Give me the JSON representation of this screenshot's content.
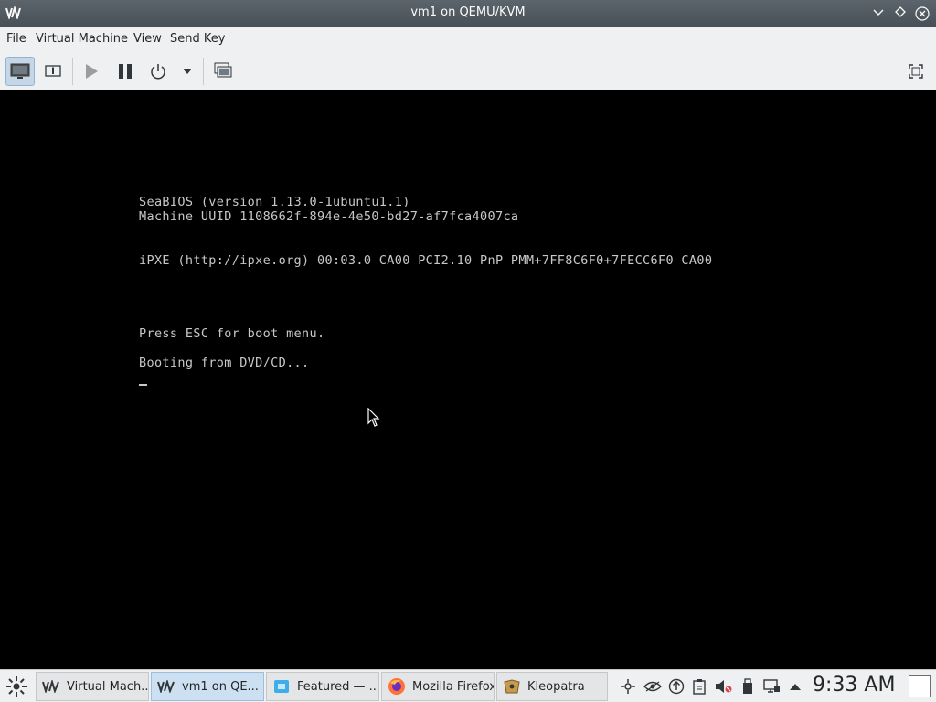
{
  "window": {
    "title": "vm1 on QEMU/KVM",
    "minimize_icon": "chevron-down-icon",
    "maximize_icon": "diamond-icon",
    "close_icon": "close-circle-icon"
  },
  "menu": {
    "items": [
      "File",
      "Virtual Machine",
      "View",
      "Send Key"
    ]
  },
  "toolbar": {
    "buttons": [
      "console-view",
      "details-view",
      "run",
      "pause",
      "shutdown",
      "shutdown-menu",
      "snapshots",
      "fullscreen"
    ],
    "active": "console-view"
  },
  "console": {
    "lines": [
      "SeaBIOS (version 1.13.0-1ubuntu1.1)",
      "Machine UUID 1108662f-894e-4e50-bd27-af7fca4007ca",
      "iPXE (http://ipxe.org) 00:03.0 CA00 PCI2.10 PnP PMM+7FF8C6F0+7FECC6F0 CA00",
      "Press ESC for boot menu.",
      "Booting from DVD/CD..."
    ],
    "text_color": "#c8c8c8",
    "background": "#000000"
  },
  "taskbar": {
    "tasks": [
      {
        "label": "Virtual Mach...",
        "icon": "virt-manager-icon",
        "active": false
      },
      {
        "label": "vm1 on QE...",
        "icon": "virt-manager-icon",
        "active": true
      },
      {
        "label": "Featured — ...",
        "icon": "discover-icon",
        "active": false
      },
      {
        "label": "Mozilla Firefox",
        "icon": "firefox-icon",
        "active": false
      },
      {
        "label": "Kleopatra",
        "icon": "kleopatra-icon",
        "active": false
      }
    ],
    "clock": "9:33 AM",
    "accent": "#cde0f1"
  }
}
